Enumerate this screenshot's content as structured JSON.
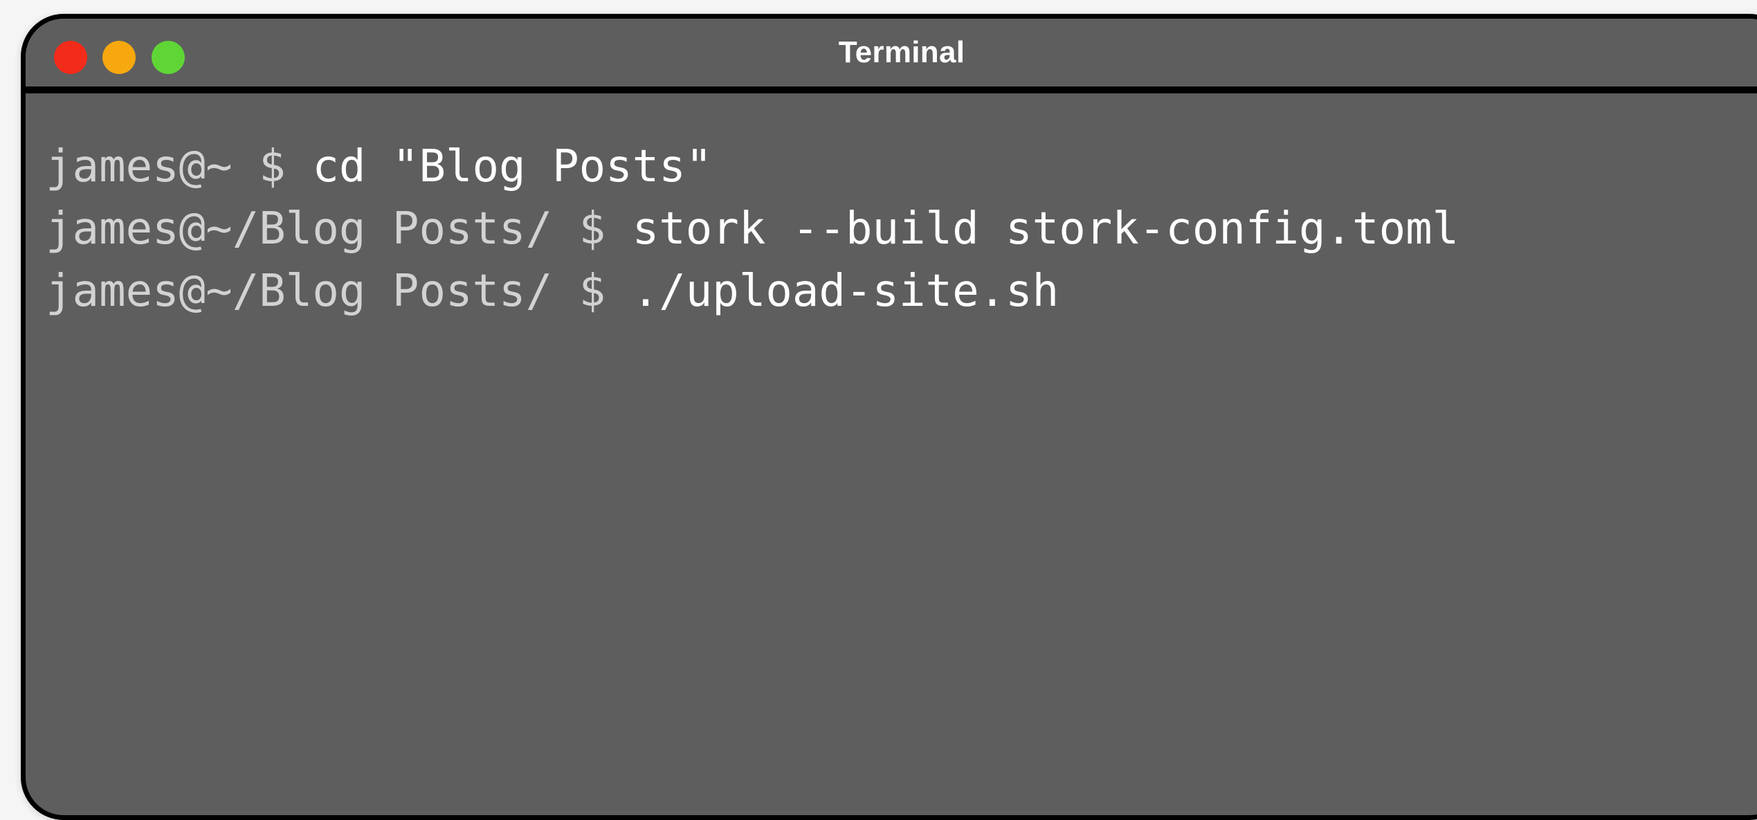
{
  "window": {
    "title": "Terminal",
    "traffic_lights": {
      "close_color": "#f22c19",
      "minimize_color": "#f7a80f",
      "zoom_color": "#5fd636"
    }
  },
  "terminal": {
    "background_color": "#5e5e5e",
    "prompt_color": "#d2d2d2",
    "command_color": "#ffffff",
    "lines": [
      {
        "prompt": "james@~ $ ",
        "command": "cd \"Blog Posts\""
      },
      {
        "prompt": "james@~/Blog Posts/ $ ",
        "command": "stork --build stork-config.toml"
      },
      {
        "prompt": "james@~/Blog Posts/ $ ",
        "command": "./upload-site.sh"
      }
    ]
  }
}
